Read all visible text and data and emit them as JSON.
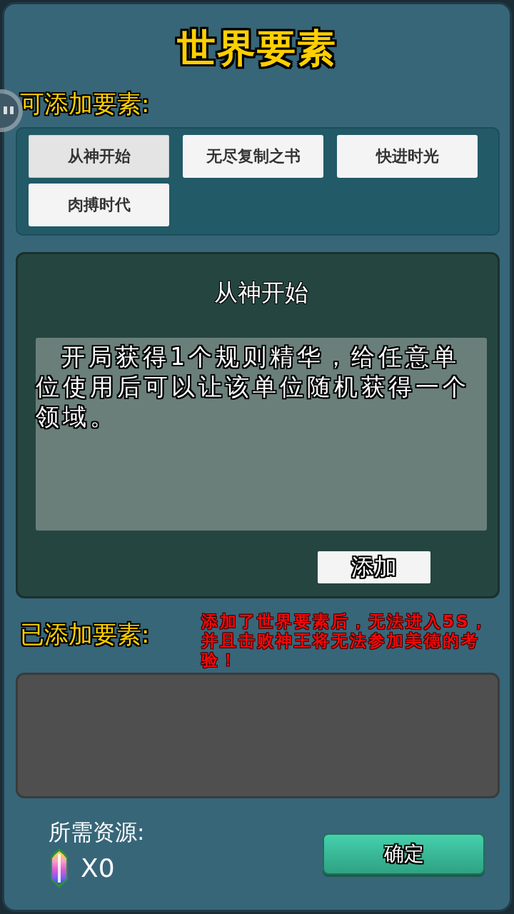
{
  "title": "世界要素",
  "available": {
    "label": "可添加要素:",
    "items": [
      {
        "label": "从神开始",
        "selected": true
      },
      {
        "label": "无尽复制之书",
        "selected": false
      },
      {
        "label": "快进时光",
        "selected": false
      },
      {
        "label": "肉搏时代",
        "selected": false
      }
    ]
  },
  "detail": {
    "title": "从神开始",
    "description": "开局获得1个规则精华，给任意单位使用后可以让该单位随机获得一个领域。",
    "add_button": "添加"
  },
  "added": {
    "label": "已添加要素:",
    "warning": "添加了世界要素后，无法进入5S，并且击败神王将无法参加美德的考验！"
  },
  "cost": {
    "label": "所需资源:",
    "amount": "X0"
  },
  "confirm_button": "确定"
}
